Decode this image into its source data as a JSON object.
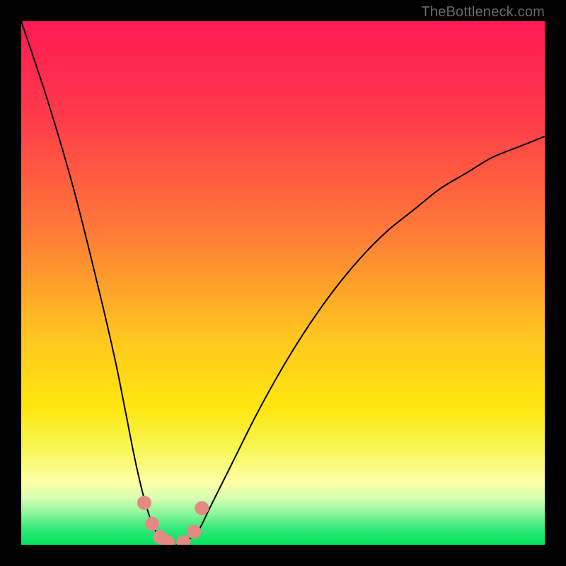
{
  "watermark": "TheBottleneck.com",
  "colors": {
    "frame": "#000000",
    "curve": "#000000",
    "marker_fill": "#e38a85",
    "green_band": "#00e35a"
  },
  "chart_data": {
    "type": "line",
    "title": "",
    "xlabel": "",
    "ylabel": "",
    "xlim": [
      0,
      100
    ],
    "ylim": [
      0,
      100
    ],
    "note": "Bottleneck curve: y is bottleneck percentage vs configuration x. Minimum (~0%) around x≈27–33 defines the green balanced band. Values estimated from pixel position; no axis labels or tick marks are present in the image.",
    "x": [
      0,
      5,
      10,
      15,
      18,
      20,
      22,
      24,
      26,
      28,
      30,
      32,
      34,
      36,
      40,
      45,
      50,
      55,
      60,
      65,
      70,
      75,
      80,
      85,
      90,
      95,
      100
    ],
    "values": [
      100,
      85,
      68,
      48,
      35,
      25,
      15,
      7,
      2,
      0,
      0,
      1,
      3,
      7,
      15,
      25,
      34,
      42,
      49,
      55,
      60,
      64,
      68,
      71,
      74,
      76,
      78
    ],
    "markers_x": [
      23.5,
      25.0,
      26.5,
      28.0,
      31.0,
      33.0,
      34.5
    ],
    "markers_y": [
      8.0,
      4.0,
      1.5,
      0.5,
      0.5,
      2.5,
      7.0
    ],
    "green_band_x": [
      26,
      34
    ],
    "gradient_stops": [
      {
        "pct": 0,
        "color": "#ff1a55"
      },
      {
        "pct": 18,
        "color": "#ff3a4a"
      },
      {
        "pct": 40,
        "color": "#ff7a38"
      },
      {
        "pct": 60,
        "color": "#ffc51f"
      },
      {
        "pct": 74,
        "color": "#ffe70f"
      },
      {
        "pct": 82,
        "color": "#f7f75a"
      },
      {
        "pct": 88,
        "color": "#ffffa8"
      },
      {
        "pct": 91,
        "color": "#d8ffb0"
      },
      {
        "pct": 94,
        "color": "#8cf59a"
      },
      {
        "pct": 97,
        "color": "#33e87a"
      },
      {
        "pct": 100,
        "color": "#00e35a"
      }
    ]
  }
}
